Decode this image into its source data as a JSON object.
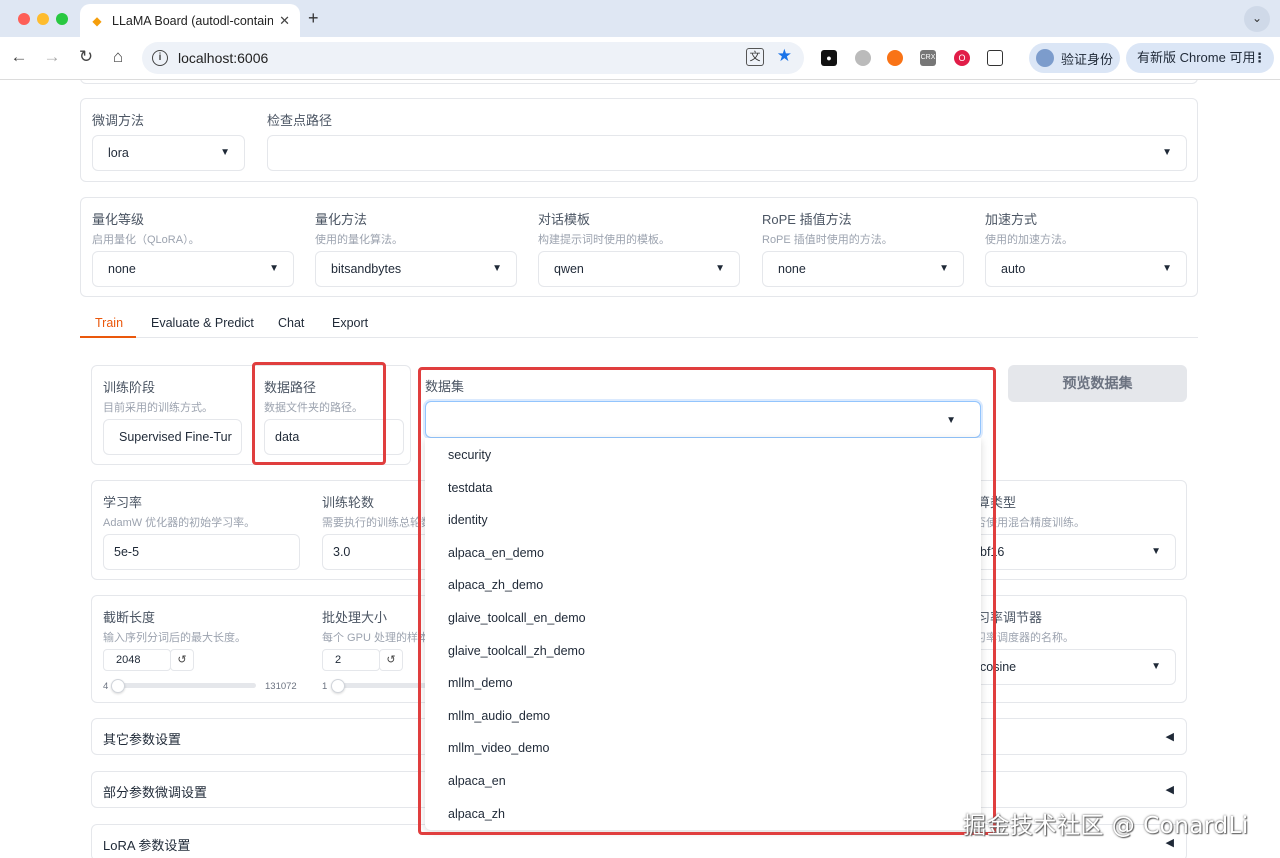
{
  "browser": {
    "tab_title": "LLaMA Board (autodl-contain",
    "url": "localhost:6006",
    "verify_label": "验证身份",
    "update_label": "有新版 Chrome 可用"
  },
  "top_panel": {
    "finetune_method": {
      "label": "微调方法",
      "value": "lora"
    },
    "checkpoint_path": {
      "label": "检查点路径",
      "value": ""
    }
  },
  "settings_panel": {
    "quant_level": {
      "label": "量化等级",
      "info": "启用量化（QLoRA）。",
      "value": "none"
    },
    "quant_method": {
      "label": "量化方法",
      "info": "使用的量化算法。",
      "value": "bitsandbytes"
    },
    "template": {
      "label": "对话模板",
      "info": "构建提示词时使用的模板。",
      "value": "qwen"
    },
    "rope": {
      "label": "RoPE 插值方法",
      "info": "RoPE 插值时使用的方法。",
      "value": "none"
    },
    "booster": {
      "label": "加速方式",
      "info": "使用的加速方法。",
      "value": "auto"
    }
  },
  "tabs": [
    "Train",
    "Evaluate & Predict",
    "Chat",
    "Export"
  ],
  "train": {
    "stage": {
      "label": "训练阶段",
      "info": "目前采用的训练方式。",
      "value": "Supervised Fine-Tur"
    },
    "dataset_dir": {
      "label": "数据路径",
      "info": "数据文件夹的路径。",
      "value": "data"
    },
    "dataset": {
      "label": "数据集",
      "value": ""
    },
    "preview_button": "预览数据集",
    "learning_rate": {
      "label": "学习率",
      "info": "AdamW 优化器的初始学习率。",
      "value": "5e-5"
    },
    "epochs": {
      "label": "训练轮数",
      "info": "需要执行的训练总轮数",
      "value": "3.0"
    },
    "compute_type": {
      "label": "计算类型",
      "info": "是否使用混合精度训练。",
      "value": "bf16"
    },
    "cutoff_len": {
      "label": "截断长度",
      "info": "输入序列分词后的最大长度。",
      "value": "2048",
      "min": "4",
      "max": "131072",
      "fraction": 0.015
    },
    "batch_size": {
      "label": "批处理大小",
      "info": "每个 GPU 处理的样本",
      "value": "2",
      "min": "1",
      "fraction": 0.01
    },
    "lr_scheduler": {
      "label": "学习率调节器",
      "info": "学习率调度器的名称。",
      "value": "cosine"
    },
    "accordions": [
      "其它参数设置",
      "部分参数微调设置",
      "LoRA 参数设置"
    ]
  },
  "dropdown_options": [
    "security",
    "testdata",
    "identity",
    "alpaca_en_demo",
    "alpaca_zh_demo",
    "glaive_toolcall_en_demo",
    "glaive_toolcall_zh_demo",
    "mllm_demo",
    "mllm_audio_demo",
    "mllm_video_demo",
    "alpaca_en",
    "alpaca_zh"
  ],
  "watermark": "掘金技术社区 @ ConardLi",
  "colors": {
    "accent": "#ea580c",
    "highlight": "#e03e3e",
    "focus": "#93c5fd"
  }
}
